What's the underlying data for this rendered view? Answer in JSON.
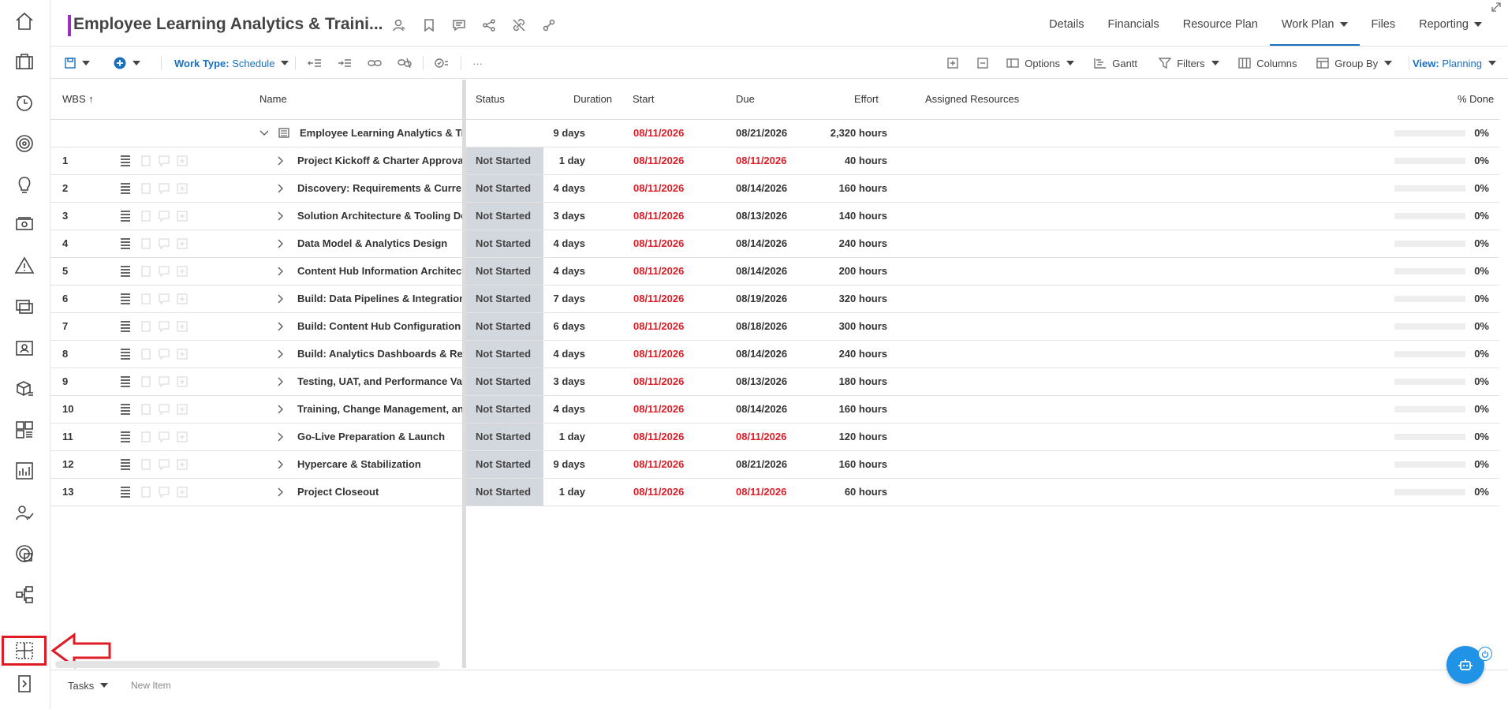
{
  "app": {
    "title": "Employee Learning Analytics & Traini...",
    "nav_tabs": [
      "Details",
      "Financials",
      "Resource Plan",
      "Work Plan",
      "Files",
      "Reporting"
    ],
    "active_tab": "Work Plan",
    "accent_color": "#1b6fbf",
    "title_marker_color": "#9b30c2",
    "alert_color": "#e01b24"
  },
  "rail": {
    "icons": [
      "home-icon",
      "briefcase-icon",
      "timesheet-icon",
      "target-icon",
      "idea-icon",
      "money-icon",
      "risk-icon",
      "screens-icon",
      "contact-card-icon",
      "products-icon",
      "dashboard-icon",
      "report-chart-icon",
      "people-icon",
      "analytics-icon",
      "hierarchy-icon",
      "layout-icon",
      "expand-rail-icon"
    ]
  },
  "toolbar": {
    "work_type_label": "Work Type:",
    "work_type_value": "Schedule",
    "more": "···",
    "options": "Options",
    "gantt": "Gantt",
    "filters": "Filters",
    "columns": "Columns",
    "group_by": "Group By",
    "view_label": "View:",
    "view_value": "Planning"
  },
  "grid": {
    "headers": {
      "wbs": "WBS",
      "name": "Name",
      "status": "Status",
      "duration": "Duration",
      "start": "Start",
      "due": "Due",
      "effort": "Effort",
      "assigned": "Assigned Resources",
      "done": "% Done"
    },
    "project_row": {
      "name": "Employee Learning Analytics & Training Hub",
      "duration": "9 days",
      "start": "08/11/2026",
      "due": "08/21/2026",
      "effort": "2,320 hours",
      "done": "0%"
    },
    "rows": [
      {
        "wbs": "1",
        "name": "Project Kickoff & Charter Approval",
        "status": "Not Started",
        "duration": "1 day",
        "start": "08/11/2026",
        "due": "08/11/2026",
        "due_red": true,
        "effort": "40 hours",
        "done": "0%"
      },
      {
        "wbs": "2",
        "name": "Discovery: Requirements & Current State",
        "status": "Not Started",
        "duration": "4 days",
        "start": "08/11/2026",
        "due": "08/14/2026",
        "due_red": false,
        "effort": "160 hours",
        "done": "0%"
      },
      {
        "wbs": "3",
        "name": "Solution Architecture & Tooling Decisions",
        "status": "Not Started",
        "duration": "3 days",
        "start": "08/11/2026",
        "due": "08/13/2026",
        "due_red": false,
        "effort": "140 hours",
        "done": "0%"
      },
      {
        "wbs": "4",
        "name": "Data Model & Analytics Design",
        "status": "Not Started",
        "duration": "4 days",
        "start": "08/11/2026",
        "due": "08/14/2026",
        "due_red": false,
        "effort": "240 hours",
        "done": "0%"
      },
      {
        "wbs": "5",
        "name": "Content Hub Information Architecture",
        "status": "Not Started",
        "duration": "4 days",
        "start": "08/11/2026",
        "due": "08/14/2026",
        "due_red": false,
        "effort": "200 hours",
        "done": "0%"
      },
      {
        "wbs": "6",
        "name": "Build: Data Pipelines & Integrations",
        "status": "Not Started",
        "duration": "7 days",
        "start": "08/11/2026",
        "due": "08/19/2026",
        "due_red": false,
        "effort": "320 hours",
        "done": "0%"
      },
      {
        "wbs": "7",
        "name": "Build: Content Hub Configuration",
        "status": "Not Started",
        "duration": "6 days",
        "start": "08/11/2026",
        "due": "08/18/2026",
        "due_red": false,
        "effort": "300 hours",
        "done": "0%"
      },
      {
        "wbs": "8",
        "name": "Build: Analytics Dashboards & Reports",
        "status": "Not Started",
        "duration": "4 days",
        "start": "08/11/2026",
        "due": "08/14/2026",
        "due_red": false,
        "effort": "240 hours",
        "done": "0%"
      },
      {
        "wbs": "9",
        "name": "Testing, UAT, and Performance Validation",
        "status": "Not Started",
        "duration": "3 days",
        "start": "08/11/2026",
        "due": "08/13/2026",
        "due_red": false,
        "effort": "180 hours",
        "done": "0%"
      },
      {
        "wbs": "10",
        "name": "Training, Change Management, and Comms",
        "status": "Not Started",
        "duration": "4 days",
        "start": "08/11/2026",
        "due": "08/14/2026",
        "due_red": false,
        "effort": "160 hours",
        "done": "0%"
      },
      {
        "wbs": "11",
        "name": "Go-Live Preparation & Launch",
        "status": "Not Started",
        "duration": "1 day",
        "start": "08/11/2026",
        "due": "08/11/2026",
        "due_red": true,
        "effort": "120 hours",
        "done": "0%"
      },
      {
        "wbs": "12",
        "name": "Hypercare & Stabilization",
        "status": "Not Started",
        "duration": "9 days",
        "start": "08/11/2026",
        "due": "08/21/2026",
        "due_red": false,
        "effort": "160 hours",
        "done": "0%"
      },
      {
        "wbs": "13",
        "name": "Project Closeout",
        "status": "Not Started",
        "duration": "1 day",
        "start": "08/11/2026",
        "due": "08/11/2026",
        "due_red": true,
        "effort": "60 hours",
        "done": "0%"
      }
    ]
  },
  "bottom": {
    "tasks_label": "Tasks",
    "new_item_placeholder": "New Item"
  }
}
